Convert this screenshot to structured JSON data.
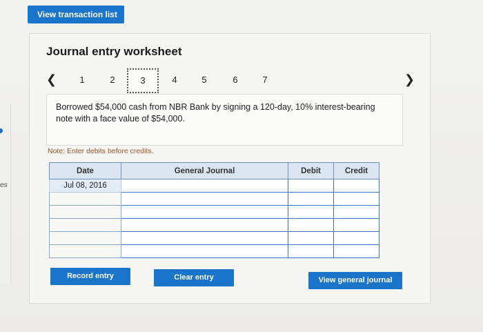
{
  "top_bar": {
    "view_transaction_list": "View transaction list"
  },
  "side": {
    "cutoff_text": "es"
  },
  "worksheet": {
    "title": "Journal entry worksheet",
    "pager": {
      "prev_icon": "chevron-left",
      "next_icon": "chevron-right",
      "pages": [
        "1",
        "2",
        "3",
        "4",
        "5",
        "6",
        "7"
      ],
      "active_page": "3"
    },
    "description": "Borrowed $54,000 cash from NBR Bank by signing a 120-day, 10% interest-bearing note with a face value of $54,000.",
    "note": "Note: Enter debits before credits.",
    "table": {
      "headers": [
        "Date",
        "General Journal",
        "Debit",
        "Credit"
      ],
      "rows": [
        [
          "Jul 08, 2016",
          "",
          "",
          ""
        ],
        [
          "",
          "",
          "",
          ""
        ],
        [
          "",
          "",
          "",
          ""
        ],
        [
          "",
          "",
          "",
          ""
        ],
        [
          "",
          "",
          "",
          ""
        ],
        [
          "",
          "",
          "",
          ""
        ]
      ]
    },
    "buttons": {
      "record_entry": "Record entry",
      "clear_entry": "Clear entry",
      "view_general_journal": "View general journal"
    }
  },
  "colors": {
    "accent": "#1a74c9",
    "note": "#a0522d",
    "table_header": "#dbe5f1"
  }
}
